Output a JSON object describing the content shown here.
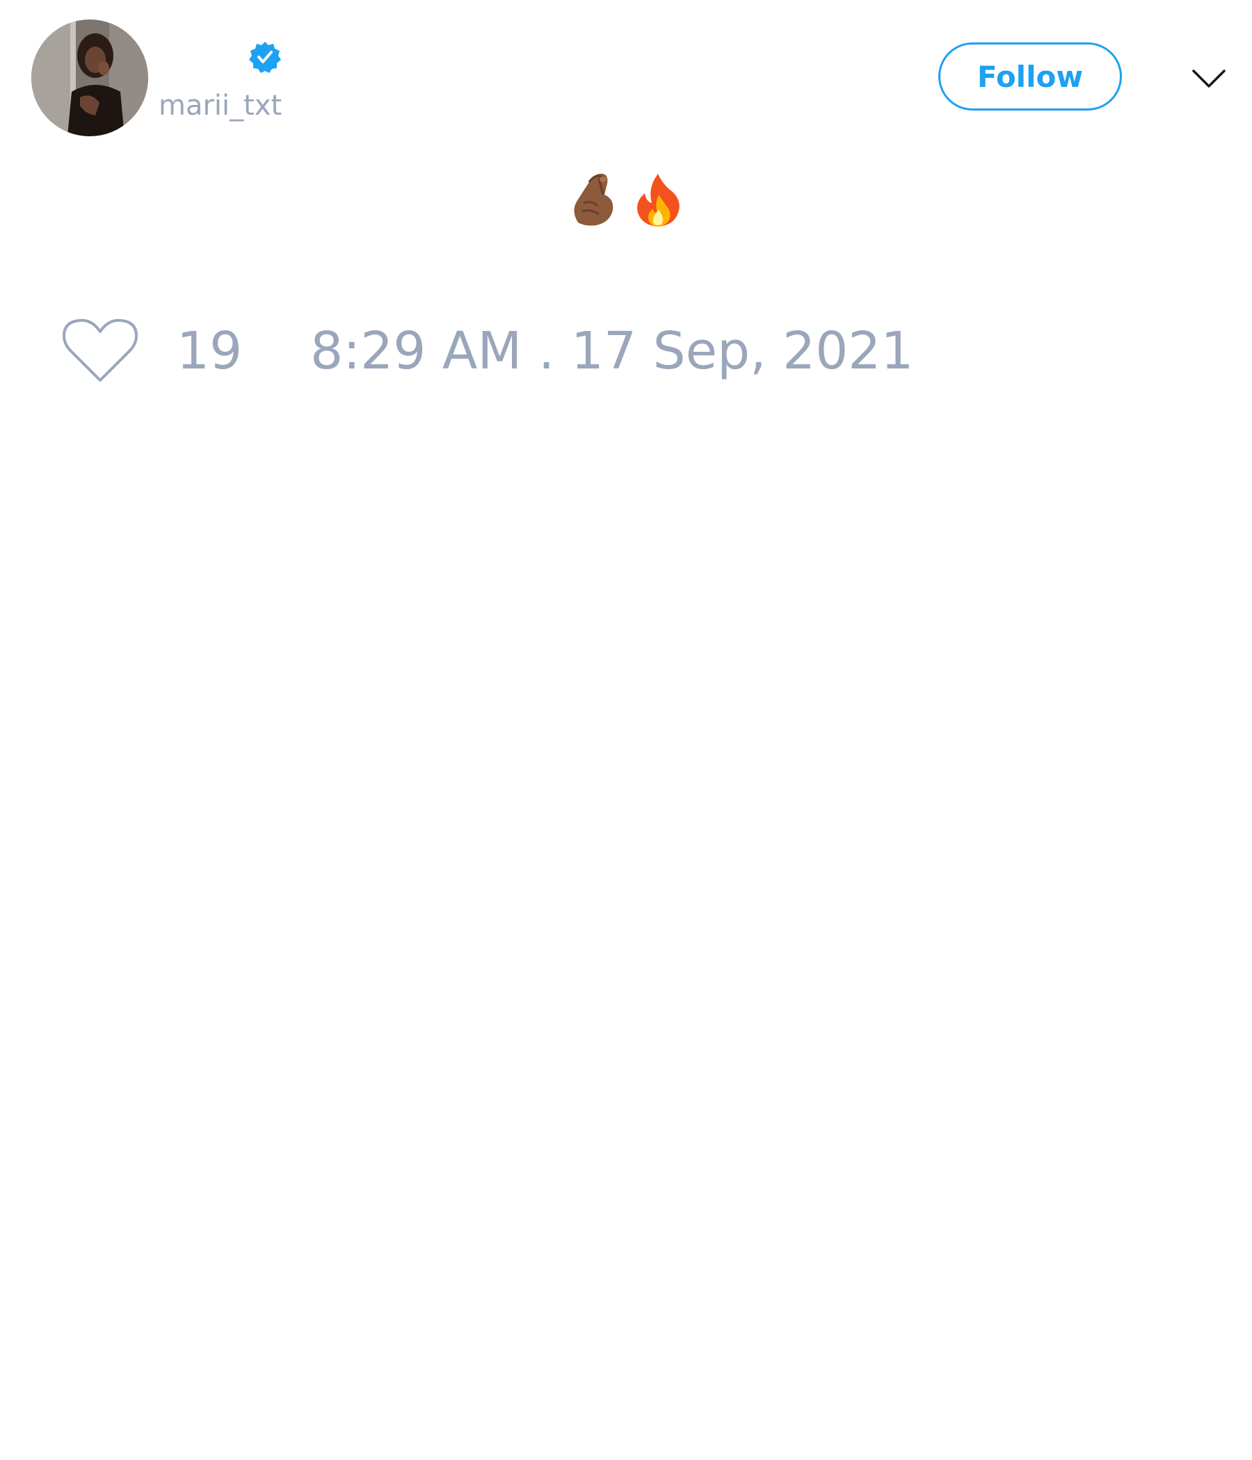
{
  "user": {
    "display_name": "",
    "handle": "marii_txt",
    "verified": true,
    "avatar_icon": "profile-photo"
  },
  "actions": {
    "follow_label": "Follow",
    "menu_icon": "chevron-down-icon"
  },
  "tweet": {
    "text": "🤌🏾🔥",
    "emoji_icons": [
      "pinched-fingers-medium-dark-skin-icon",
      "fire-icon"
    ]
  },
  "footer": {
    "like_icon": "heart-icon",
    "like_count": "19",
    "timestamp": "8:29 AM . 17 Sep, 2021"
  },
  "colors": {
    "accent": "#1da1f2",
    "muted_text": "#9aa6ba",
    "primary_text": "#14171a",
    "background": "#ffffff"
  }
}
